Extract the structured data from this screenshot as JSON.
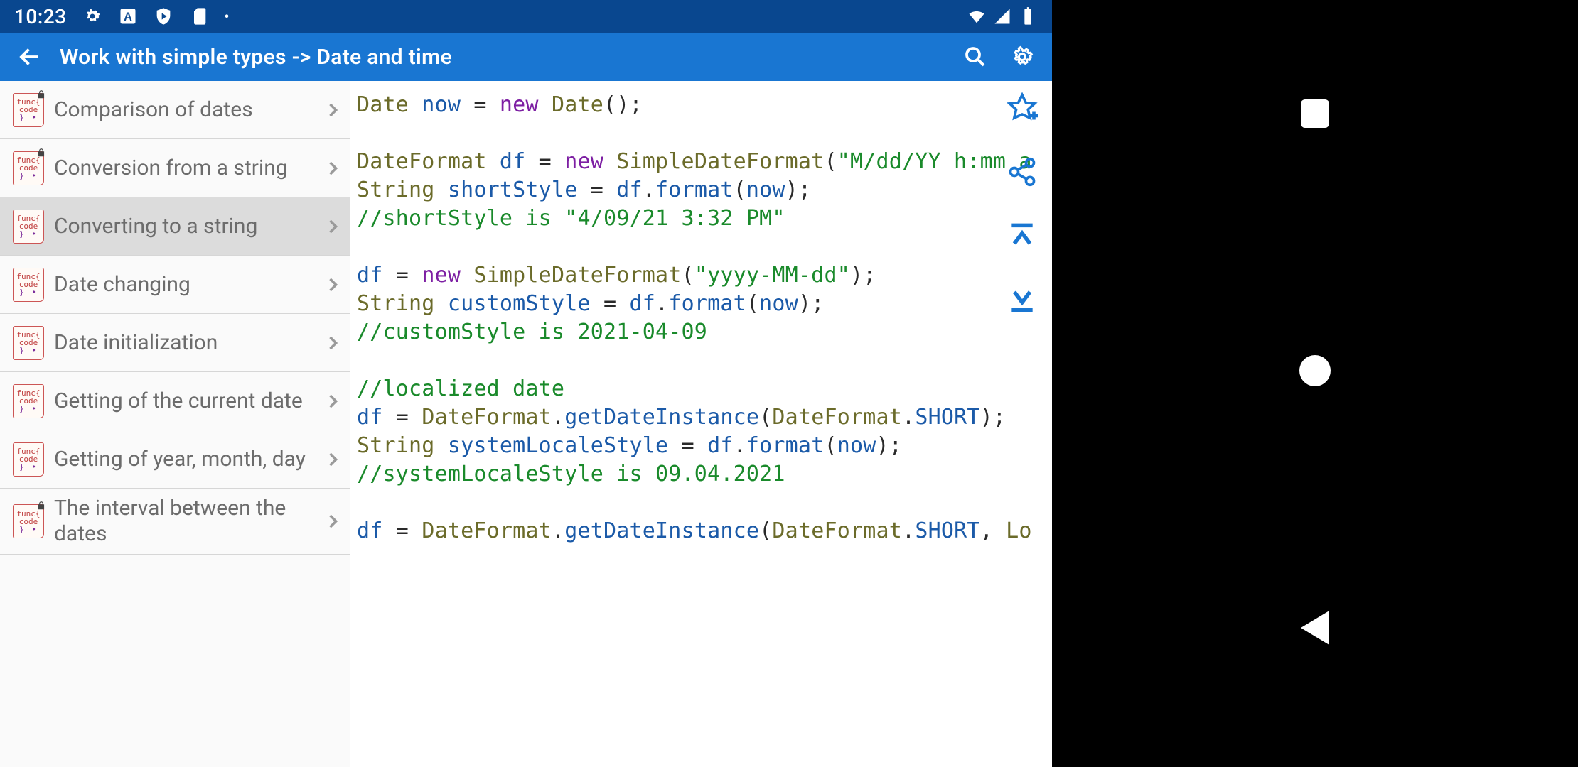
{
  "status": {
    "time": "10:23",
    "icons_left": [
      "gear-icon",
      "a-box-icon",
      "shield-play-icon",
      "sd-card-icon",
      "dot-icon"
    ],
    "icons_right": [
      "wifi-icon",
      "cell-signal-icon",
      "battery-full-icon"
    ]
  },
  "appbar": {
    "title": "Work with simple types -> Date and time"
  },
  "sidebar": {
    "items": [
      {
        "label": "Comparison of dates",
        "locked": true,
        "selected": false
      },
      {
        "label": "Conversion from a string",
        "locked": true,
        "selected": false
      },
      {
        "label": "Converting to a string",
        "locked": false,
        "selected": true
      },
      {
        "label": "Date changing",
        "locked": false,
        "selected": false
      },
      {
        "label": "Date initialization",
        "locked": false,
        "selected": false
      },
      {
        "label": "Getting of the current date",
        "locked": false,
        "selected": false
      },
      {
        "label": "Getting of year, month, day",
        "locked": false,
        "selected": false
      },
      {
        "label": "The interval between the dates",
        "locked": true,
        "selected": false
      }
    ]
  },
  "code": {
    "lines": [
      [
        {
          "t": "Date",
          "c": "tk-type"
        },
        {
          "t": " now ",
          "c": "tk-blue"
        },
        {
          "t": "= ",
          "c": "tk-op"
        },
        {
          "t": "new ",
          "c": "tk-purp"
        },
        {
          "t": "Date",
          "c": "tk-type"
        },
        {
          "t": "();",
          "c": "tk-op"
        }
      ],
      [],
      [
        {
          "t": "DateFormat",
          "c": "tk-type"
        },
        {
          "t": " df ",
          "c": "tk-blue"
        },
        {
          "t": "= ",
          "c": "tk-op"
        },
        {
          "t": "new ",
          "c": "tk-purp"
        },
        {
          "t": "SimpleDateFormat",
          "c": "tk-type"
        },
        {
          "t": "(",
          "c": "tk-op"
        },
        {
          "t": "\"M/dd/YY h:mm a",
          "c": "tk-str"
        }
      ],
      [
        {
          "t": "String",
          "c": "tk-type"
        },
        {
          "t": " shortStyle ",
          "c": "tk-blue"
        },
        {
          "t": "= ",
          "c": "tk-op"
        },
        {
          "t": "df",
          "c": "tk-blue"
        },
        {
          "t": ".",
          "c": "tk-op"
        },
        {
          "t": "format",
          "c": "tk-blue"
        },
        {
          "t": "(",
          "c": "tk-op"
        },
        {
          "t": "now",
          "c": "tk-blue"
        },
        {
          "t": ");",
          "c": "tk-op"
        }
      ],
      [
        {
          "t": "//shortStyle is \"4/09/21 3:32 PM\"",
          "c": "tk-cmt"
        }
      ],
      [],
      [
        {
          "t": "df ",
          "c": "tk-blue"
        },
        {
          "t": "= ",
          "c": "tk-op"
        },
        {
          "t": "new ",
          "c": "tk-purp"
        },
        {
          "t": "SimpleDateFormat",
          "c": "tk-type"
        },
        {
          "t": "(",
          "c": "tk-op"
        },
        {
          "t": "\"yyyy-MM-dd\"",
          "c": "tk-str"
        },
        {
          "t": ");",
          "c": "tk-op"
        }
      ],
      [
        {
          "t": "String",
          "c": "tk-type"
        },
        {
          "t": " customStyle ",
          "c": "tk-blue"
        },
        {
          "t": "= ",
          "c": "tk-op"
        },
        {
          "t": "df",
          "c": "tk-blue"
        },
        {
          "t": ".",
          "c": "tk-op"
        },
        {
          "t": "format",
          "c": "tk-blue"
        },
        {
          "t": "(",
          "c": "tk-op"
        },
        {
          "t": "now",
          "c": "tk-blue"
        },
        {
          "t": ");",
          "c": "tk-op"
        }
      ],
      [
        {
          "t": "//customStyle is 2021-04-09",
          "c": "tk-cmt"
        }
      ],
      [],
      [
        {
          "t": "//localized date",
          "c": "tk-cmt"
        }
      ],
      [
        {
          "t": "df ",
          "c": "tk-blue"
        },
        {
          "t": "= ",
          "c": "tk-op"
        },
        {
          "t": "DateFormat",
          "c": "tk-type"
        },
        {
          "t": ".",
          "c": "tk-op"
        },
        {
          "t": "getDateInstance",
          "c": "tk-blue"
        },
        {
          "t": "(",
          "c": "tk-op"
        },
        {
          "t": "DateFormat",
          "c": "tk-type"
        },
        {
          "t": ".",
          "c": "tk-op"
        },
        {
          "t": "SHORT",
          "c": "tk-const"
        },
        {
          "t": ");",
          "c": "tk-op"
        }
      ],
      [
        {
          "t": "String",
          "c": "tk-type"
        },
        {
          "t": " systemLocaleStyle ",
          "c": "tk-blue"
        },
        {
          "t": "= ",
          "c": "tk-op"
        },
        {
          "t": "df",
          "c": "tk-blue"
        },
        {
          "t": ".",
          "c": "tk-op"
        },
        {
          "t": "format",
          "c": "tk-blue"
        },
        {
          "t": "(",
          "c": "tk-op"
        },
        {
          "t": "now",
          "c": "tk-blue"
        },
        {
          "t": ");",
          "c": "tk-op"
        }
      ],
      [
        {
          "t": "//systemLocaleStyle is 09.04.2021",
          "c": "tk-cmt"
        }
      ],
      [],
      [
        {
          "t": "df ",
          "c": "tk-blue"
        },
        {
          "t": "= ",
          "c": "tk-op"
        },
        {
          "t": "DateFormat",
          "c": "tk-type"
        },
        {
          "t": ".",
          "c": "tk-op"
        },
        {
          "t": "getDateInstance",
          "c": "tk-blue"
        },
        {
          "t": "(",
          "c": "tk-op"
        },
        {
          "t": "DateFormat",
          "c": "tk-type"
        },
        {
          "t": ".",
          "c": "tk-op"
        },
        {
          "t": "SHORT",
          "c": "tk-const"
        },
        {
          "t": ", ",
          "c": "tk-op"
        },
        {
          "t": "Lo",
          "c": "tk-type"
        }
      ]
    ]
  },
  "float_actions": [
    "star-add-icon",
    "share-icon",
    "scroll-top-icon",
    "scroll-bottom-icon"
  ]
}
